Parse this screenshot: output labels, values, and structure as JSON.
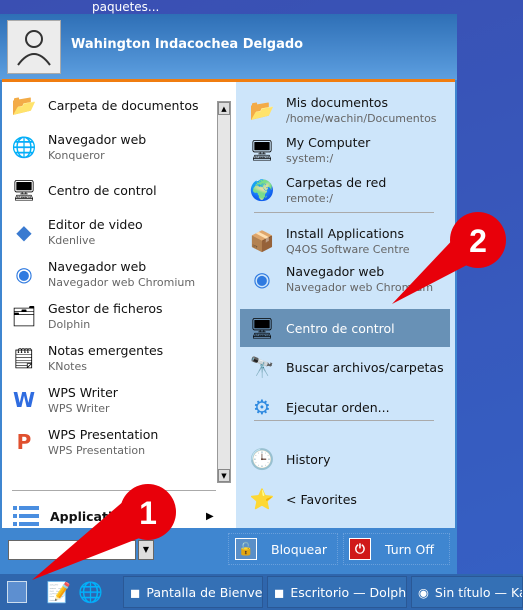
{
  "desktop": {
    "top_text": "paquetes..."
  },
  "user": {
    "name": "Wahington Indacochea Delgado"
  },
  "left_items": [
    {
      "title": "Carpeta de documentos",
      "sub": "",
      "icon": "folder-icon"
    },
    {
      "title": "Navegador web",
      "sub": "Konqueror",
      "icon": "konqueror-icon"
    },
    {
      "title": "Centro de control",
      "sub": "",
      "icon": "control-center-icon"
    },
    {
      "title": "Editor de video",
      "sub": "Kdenlive",
      "icon": "kdenlive-icon"
    },
    {
      "title": "Navegador web",
      "sub": "Navegador web Chromium",
      "icon": "chromium-icon"
    },
    {
      "title": "Gestor de ficheros",
      "sub": "Dolphin",
      "icon": "dolphin-icon"
    },
    {
      "title": "Notas emergentes",
      "sub": "KNotes",
      "icon": "knotes-icon"
    },
    {
      "title": "WPS Writer",
      "sub": "WPS Writer",
      "icon": "wps-writer-icon"
    },
    {
      "title": "WPS Presentation",
      "sub": "WPS Presentation",
      "icon": "wps-presentation-icon"
    }
  ],
  "applications": {
    "label": "Applications"
  },
  "right_items": [
    {
      "title": "Mis documentos",
      "sub": "/home/wachin/Documentos",
      "icon": "folder-icon"
    },
    {
      "title": "My Computer",
      "sub": "system:/",
      "icon": "computer-icon"
    },
    {
      "title": "Carpetas de red",
      "sub": "remote:/",
      "icon": "network-globe-icon"
    },
    {
      "title": "Install Applications",
      "sub": "Q4OS Software Centre",
      "icon": "package-icon"
    },
    {
      "title": "Navegador web",
      "sub": "Navegador web Chromium",
      "icon": "chromium-icon"
    },
    {
      "title": "Centro de control",
      "sub": "",
      "icon": "control-center-icon",
      "highlighted": true
    },
    {
      "title": "Buscar archivos/carpetas",
      "sub": "",
      "icon": "search-binoculars-icon"
    },
    {
      "title": "Ejecutar orden...",
      "sub": "",
      "icon": "run-gear-icon"
    },
    {
      "title": "History",
      "sub": "",
      "icon": "clock-icon"
    },
    {
      "title": "< Favorites",
      "sub": "",
      "icon": "star-icon"
    }
  ],
  "search": {
    "value": ""
  },
  "buttons": {
    "lock": "Bloquear",
    "turn_off": "Turn Off"
  },
  "taskbar": {
    "tasks": [
      "Pantalla de Bienvenida",
      "Escritorio — Dolphin",
      "Sin título — Ka"
    ]
  },
  "annotations": [
    "1",
    "2"
  ],
  "colors": {
    "highlight": "#6891b6",
    "accent_line": "#f07d10",
    "annotation": "#e8000a"
  }
}
